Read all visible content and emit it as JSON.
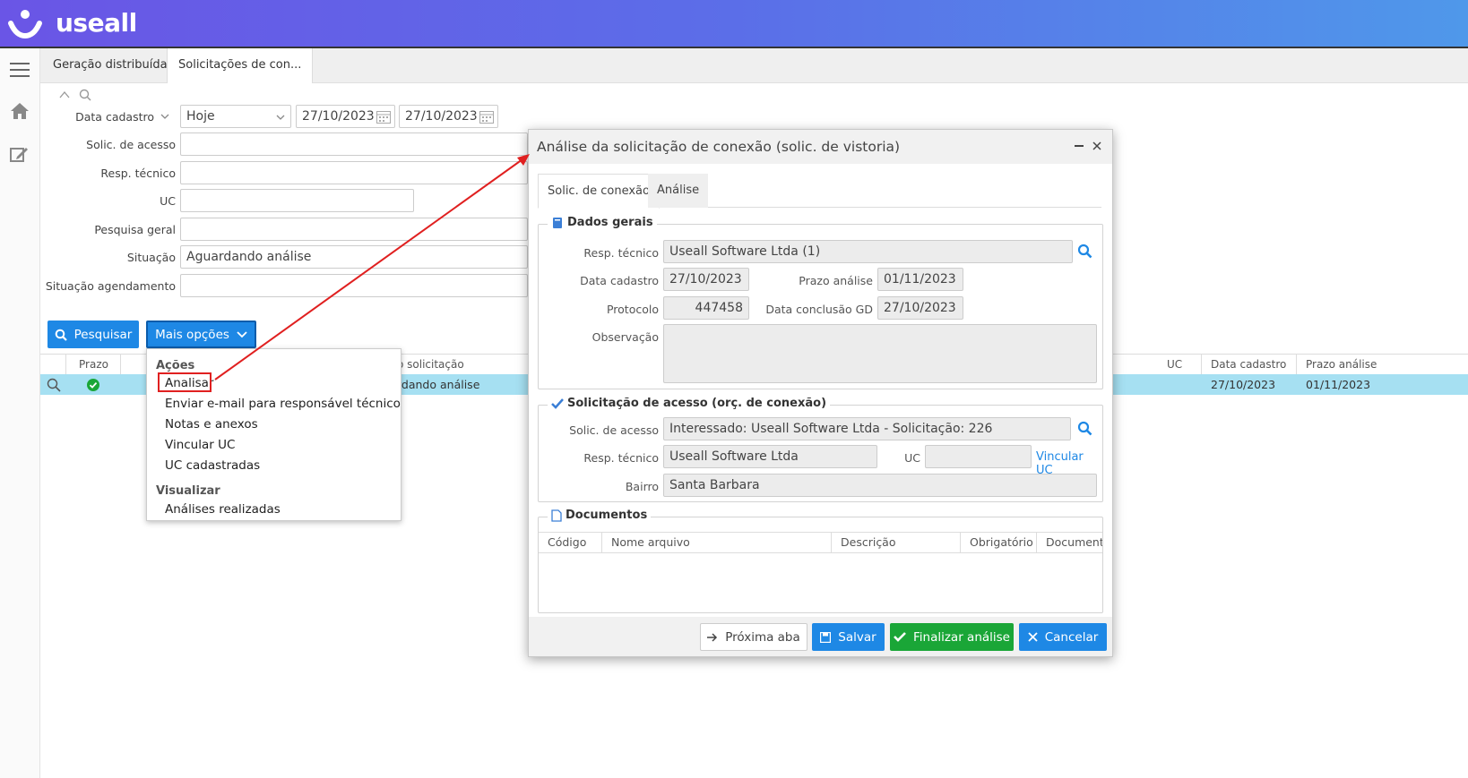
{
  "app": {
    "brand": "useall"
  },
  "tabs": [
    {
      "label": "Geração distribuída"
    },
    {
      "label": "Solicitações de con..."
    }
  ],
  "filters": {
    "data_cadastro_label": "Data cadastro",
    "period_value": "Hoje",
    "date_from": "27/10/2023",
    "date_to": "27/10/2023",
    "solic_acesso_label": "Solic. de acesso",
    "resp_tecnico_label": "Resp. técnico",
    "uc_label": "UC",
    "pesquisa_geral_label": "Pesquisa geral",
    "situacao_label": "Situação",
    "situacao_value": "Aguardando análise",
    "situacao_agendamento_label": "Situação agendamento"
  },
  "buttons": {
    "pesquisar": "Pesquisar",
    "mais_opcoes": "Mais opções"
  },
  "grid": {
    "headers": {
      "prazo": "Prazo",
      "situacao_solicitacao": "o solicitação",
      "uc": "UC",
      "data_cadastro": "Data cadastro",
      "prazo_analise": "Prazo análise"
    },
    "row": {
      "situacao": "rdando análise",
      "data_cadastro": "27/10/2023",
      "prazo_analise": "01/11/2023"
    }
  },
  "menu": {
    "acoes_header": "Ações",
    "items": [
      "Analisar",
      "Enviar e-mail para responsável técnico",
      "Notas e anexos",
      "Vincular UC",
      "UC cadastradas"
    ],
    "visualizar_header": "Visualizar",
    "visualizar_items": [
      "Análises realizadas"
    ]
  },
  "modal": {
    "title": "Análise da solicitação de conexão (solic. de vistoria)",
    "tabs": [
      "Solic. de conexão",
      "Análise"
    ],
    "dados_gerais": {
      "legend": "Dados gerais",
      "resp_tecnico_label": "Resp. técnico",
      "resp_tecnico_value": "Useall Software Ltda (1)",
      "data_cadastro_label": "Data cadastro",
      "data_cadastro_value": "27/10/2023",
      "prazo_analise_label": "Prazo análise",
      "prazo_analise_value": "01/11/2023",
      "protocolo_label": "Protocolo",
      "protocolo_value": "447458",
      "data_conclusao_label": "Data conclusão GD",
      "data_conclusao_value": "27/10/2023",
      "observacao_label": "Observação"
    },
    "solicitacao_acesso": {
      "legend": "Solicitação de acesso (orç. de conexão)",
      "solic_acesso_label": "Solic. de acesso",
      "solic_acesso_value": "Interessado: Useall Software Ltda - Solicitação: 226",
      "resp_tecnico_label": "Resp. técnico",
      "resp_tecnico_value": "Useall Software Ltda",
      "uc_label": "UC",
      "vincular_uc_link": "Vincular UC",
      "bairro_label": "Bairro",
      "bairro_value": "Santa Barbara"
    },
    "documentos": {
      "legend": "Documentos",
      "columns": [
        "Código",
        "Nome arquivo",
        "Descrição",
        "Obrigatório",
        "Documento"
      ]
    },
    "footer": {
      "proxima_aba": "Próxima aba",
      "salvar": "Salvar",
      "finalizar": "Finalizar análise",
      "cancelar": "Cancelar"
    }
  },
  "colors": {
    "primary_button": "#1e88e5",
    "success_button": "#1aa637",
    "highlight": "#e02020",
    "row_selected": "#a6e0f2"
  }
}
